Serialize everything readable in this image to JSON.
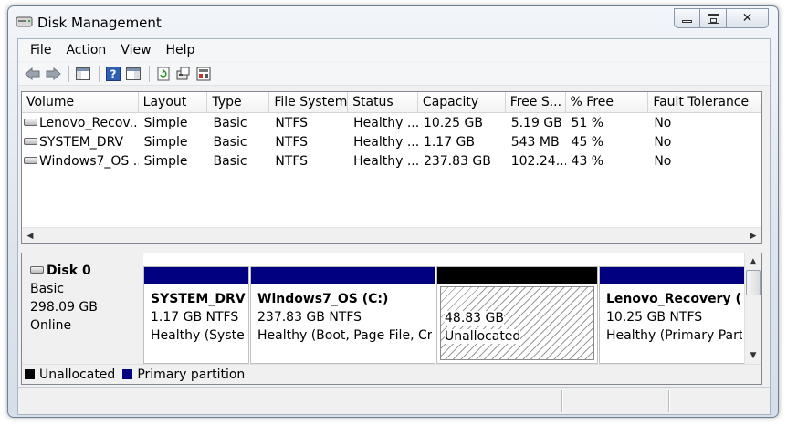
{
  "window": {
    "title": "Disk Management"
  },
  "menu": [
    "File",
    "Action",
    "View",
    "Help"
  ],
  "toolbar": [
    "back-icon",
    "forward-icon",
    "show-hide-console-tree-icon",
    "help-icon",
    "properties-icon",
    "refresh-icon",
    "rescan-disks-icon",
    "settings-icon"
  ],
  "columns": [
    "Volume",
    "Layout",
    "Type",
    "File System",
    "Status",
    "Capacity",
    "Free S...",
    "% Free",
    "Fault Tolerance"
  ],
  "volumes": [
    {
      "volume": "Lenovo_Recov...",
      "layout": "Simple",
      "type": "Basic",
      "fs": "NTFS",
      "status": "Healthy ...",
      "capacity": "10.25 GB",
      "free": "5.19 GB",
      "pct": "51 %",
      "fault": "No"
    },
    {
      "volume": "SYSTEM_DRV",
      "layout": "Simple",
      "type": "Basic",
      "fs": "NTFS",
      "status": "Healthy ...",
      "capacity": "1.17 GB",
      "free": "543 MB",
      "pct": "45 %",
      "fault": "No"
    },
    {
      "volume": "Windows7_OS ...",
      "layout": "Simple",
      "type": "Basic",
      "fs": "NTFS",
      "status": "Healthy ...",
      "capacity": "237.83 GB",
      "free": "102.24...",
      "pct": "43 %",
      "fault": "No"
    }
  ],
  "disk": {
    "name": "Disk 0",
    "type": "Basic",
    "size": "298.09 GB",
    "state": "Online"
  },
  "partitions": [
    {
      "name": "SYSTEM_DRV",
      "size": "1.17 GB NTFS",
      "status": "Healthy (System",
      "bar_color": "#000080"
    },
    {
      "name": "Windows7_OS  (C:)",
      "size": "237.83 GB NTFS",
      "status": "Healthy (Boot, Page File, Cra",
      "bar_color": "#000080"
    },
    {
      "name": "",
      "size": "48.83 GB",
      "status": "Unallocated",
      "bar_color": "#000000"
    },
    {
      "name": "Lenovo_Recovery  (",
      "size": "10.25 GB NTFS",
      "status": "Healthy (Primary Part",
      "bar_color": "#000080"
    }
  ],
  "legend": [
    {
      "label": "Unallocated",
      "color": "#000000"
    },
    {
      "label": "Primary partition",
      "color": "#000080"
    }
  ]
}
